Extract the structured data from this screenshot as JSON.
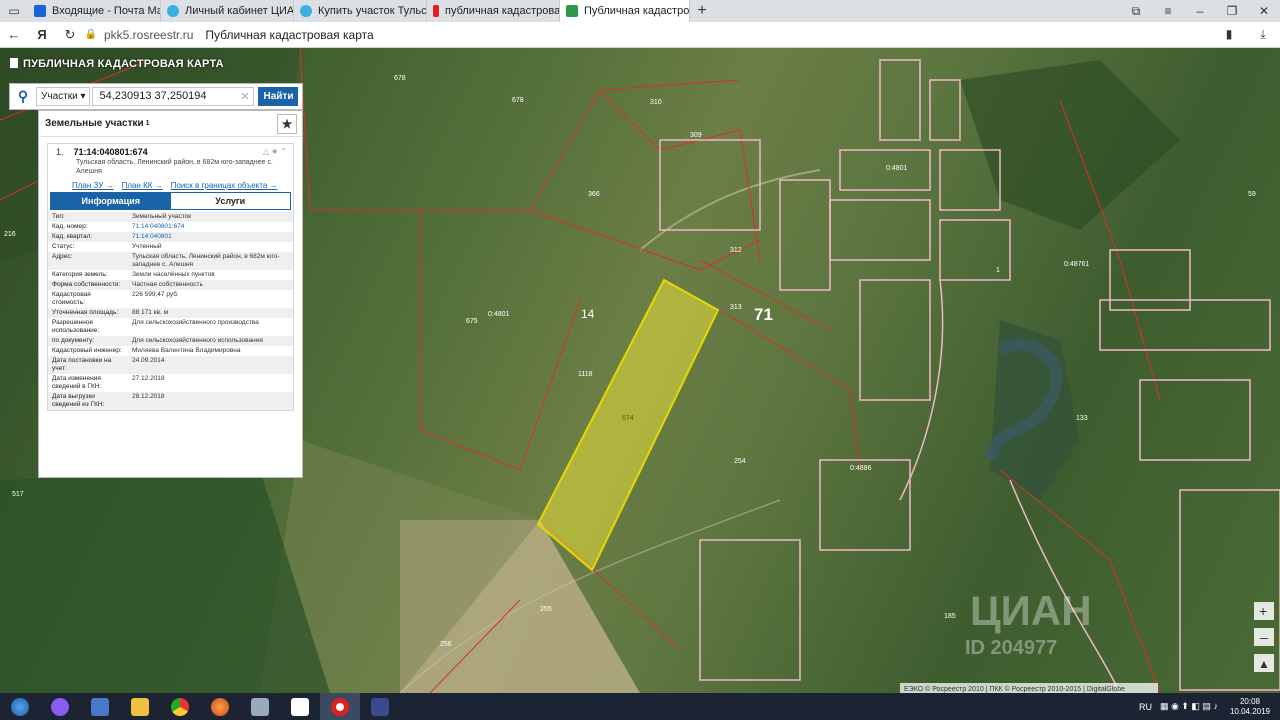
{
  "browser": {
    "tabs": [
      {
        "label": "Входящие - Почта Mail.Ru",
        "color": "#1a63d6"
      },
      {
        "label": "Личный кабинет ЦИАН",
        "color": "#3ab0e0"
      },
      {
        "label": "Купить участок Тульская о",
        "color": "#3ab0e0"
      },
      {
        "label": "публичная кадастровая ка",
        "color": "#e02020"
      },
      {
        "label": "Публичная кадастровая",
        "color": "#2a9a4a",
        "active": true
      }
    ],
    "url": "pkk5.rosreestr.ru",
    "page_title": "Публичная кадастровая карта"
  },
  "app": {
    "title": "ПУБЛИЧНАЯ КАДАСТРОВАЯ КАРТА",
    "search": {
      "type": "Участки",
      "value": "54,230913 37,250194",
      "button": "Найти"
    },
    "panel": {
      "heading": "Земельные участки",
      "heading_count": "1",
      "item_index": "1.",
      "cad_number": "71:14:040801:674",
      "address_short": "Тульская область, Ленинский район, в 682м юго-западнее с. Алешня",
      "links": [
        "План ЗУ →",
        "План КК →",
        "Поиск в границах объекта →"
      ],
      "tabs": {
        "info": "Информация",
        "services": "Услуги"
      },
      "rows": [
        {
          "k": "Тип:",
          "v": "Земельный участок"
        },
        {
          "k": "Кад. номер:",
          "v": "71:14:040801:674",
          "link": true
        },
        {
          "k": "Кад. квартал:",
          "v": "71:14:040801",
          "link": true
        },
        {
          "k": "Статус:",
          "v": "Учтенный"
        },
        {
          "k": "Адрес:",
          "v": "Тульская область, Ленинский район, в 682м юго-западнее с. Алешня"
        },
        {
          "k": "Категория земель:",
          "v": "Земли населённых пунктов"
        },
        {
          "k": "Форма собственности:",
          "v": "Частная собственность"
        },
        {
          "k": "Кадастровая стоимость:",
          "v": "226 599,47 руб."
        },
        {
          "k": "Уточненная площадь:",
          "v": "88 171 кв. м"
        },
        {
          "k": "Разрешенное использование:",
          "v": "Для сельскохозяйственного производства"
        },
        {
          "k": "по документу:",
          "v": "Для сельскохозяйственного использования"
        },
        {
          "k": "Кадастровый инженер:",
          "v": "Миляева Валентина Владимировна"
        },
        {
          "k": "Дата постановки на учет:",
          "v": "24.09.2014"
        },
        {
          "k": "Дата изменения сведений в ГКН:",
          "v": "27.12.2018"
        },
        {
          "k": "Дата выгрузки сведений из ГКН:",
          "v": "28.12.2018"
        }
      ]
    }
  },
  "map": {
    "labels": [
      "678",
      "678",
      "310",
      "309",
      "366",
      "312",
      "313",
      "71",
      "14",
      "675",
      "0:4801",
      "1118",
      "674",
      "254",
      "255",
      "256",
      "517",
      "216",
      "59",
      "0:48761",
      "1",
      "133",
      "185",
      "0:4886",
      "0:4801"
    ],
    "attribution": "ЕЭКО © Росреестр 2010 | ПКК © Росреестр 2010-2015 | DigitalGlobe",
    "watermark": "ЦИАН",
    "watermark_id": "ID 204977"
  },
  "taskbar": {
    "lang": "RU",
    "time": "20:08",
    "date": "10.04.2019"
  }
}
